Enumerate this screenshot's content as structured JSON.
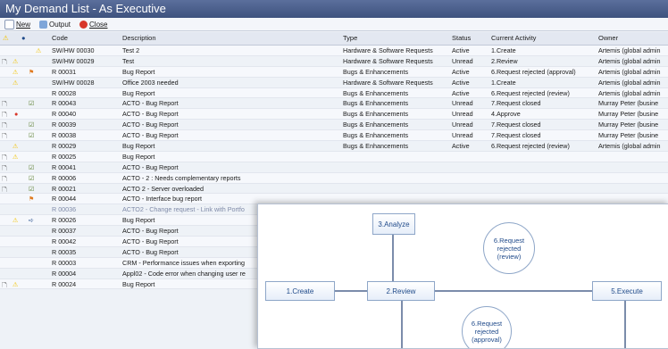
{
  "window": {
    "title": "My Demand List - As Executive"
  },
  "toolbar": {
    "new_label": "New",
    "output_label": "Output",
    "close_label": "Close"
  },
  "columns": {
    "code": "Code",
    "description": "Description",
    "type": "Type",
    "status": "Status",
    "activity": "Current Activity",
    "owner": "Owner"
  },
  "rows": [
    {
      "code": "SW/HW 00030",
      "description": "Test 2",
      "type": "Hardware & Software Requests",
      "status": "Active",
      "activity": "1.Create",
      "owner": "Artemis (global admin"
    },
    {
      "code": "SW/HW 00029",
      "description": "Test",
      "type": "Hardware & Software Requests",
      "status": "Unread",
      "activity": "2.Review",
      "owner": "Artemis (global admin"
    },
    {
      "code": "R 00031",
      "description": "Bug Report",
      "type": "Bugs & Enhancements",
      "status": "Active",
      "activity": "6.Request rejected (approval)",
      "owner": "Artemis (global admin"
    },
    {
      "code": "SW/HW 00028",
      "description": "Office 2003 needed",
      "type": "Hardware & Software Requests",
      "status": "Active",
      "activity": "1.Create",
      "owner": "Artemis (global admin"
    },
    {
      "code": "R 00028",
      "description": "Bug Report",
      "type": "Bugs & Enhancements",
      "status": "Active",
      "activity": "6.Request rejected (review)",
      "owner": "Artemis (global admin"
    },
    {
      "code": "R 00043",
      "description": "ACTO - Bug Report",
      "type": "Bugs & Enhancements",
      "status": "Unread",
      "activity": "7.Request closed",
      "owner": "Murray Peter (busine"
    },
    {
      "code": "R 00040",
      "description": "ACTO - Bug Report",
      "type": "Bugs & Enhancements",
      "status": "Unread",
      "activity": "4.Approve",
      "owner": "Murray Peter (busine"
    },
    {
      "code": "R 00039",
      "description": "ACTO - Bug Report",
      "type": "Bugs & Enhancements",
      "status": "Unread",
      "activity": "7.Request closed",
      "owner": "Murray Peter (busine"
    },
    {
      "code": "R 00038",
      "description": "ACTO - Bug Report",
      "type": "Bugs & Enhancements",
      "status": "Unread",
      "activity": "7.Request closed",
      "owner": "Murray Peter (busine"
    },
    {
      "code": "R 00029",
      "description": "Bug Report",
      "type": "Bugs & Enhancements",
      "status": "Active",
      "activity": "6.Request rejected (review)",
      "owner": "Artemis (global admin"
    },
    {
      "code": "R 00025",
      "description": "Bug Report",
      "type": "",
      "status": "",
      "activity": "",
      "owner": ""
    },
    {
      "code": "R 00041",
      "description": "ACTO - Bug Report",
      "type": "",
      "status": "",
      "activity": "",
      "owner": ""
    },
    {
      "code": "R 00006",
      "description": "ACTO - 2 : Needs complementary reports",
      "type": "",
      "status": "",
      "activity": "",
      "owner": ""
    },
    {
      "code": "R 00021",
      "description": "ACTO 2 - Server overloaded",
      "type": "",
      "status": "",
      "activity": "",
      "owner": ""
    },
    {
      "code": "R 00044",
      "description": "ACTO - Interface bug report",
      "type": "",
      "status": "",
      "activity": "",
      "owner": ""
    },
    {
      "code": "R 00036",
      "description": "ACTO2 - Change request - Link with Portfo",
      "type": "",
      "status": "",
      "activity": "",
      "owner": ""
    },
    {
      "code": "R 00026",
      "description": "Bug Report",
      "type": "",
      "status": "",
      "activity": "",
      "owner": ""
    },
    {
      "code": "R 00037",
      "description": "ACTO - Bug Report",
      "type": "",
      "status": "",
      "activity": "",
      "owner": ""
    },
    {
      "code": "R 00042",
      "description": "ACTO - Bug Report",
      "type": "",
      "status": "",
      "activity": "",
      "owner": ""
    },
    {
      "code": "R 00035",
      "description": "ACTO - Bug Report",
      "type": "",
      "status": "",
      "activity": "",
      "owner": ""
    },
    {
      "code": "R 00003",
      "description": "CRM - Performance issues when exporting",
      "type": "",
      "status": "",
      "activity": "",
      "owner": ""
    },
    {
      "code": "R 00004",
      "description": "Appl02 - Code error when changing user re",
      "type": "",
      "status": "",
      "activity": "",
      "owner": ""
    },
    {
      "code": "R 00024",
      "description": "Bug Report",
      "type": "",
      "status": "",
      "activity": "",
      "owner": ""
    }
  ],
  "workflow": {
    "analyze": "3.Analyze",
    "create": "1.Create",
    "review": "2.Review",
    "rejected_review": "6.Request rejected (review)",
    "rejected_approval": "6.Request rejected (approval)",
    "execute": "5.Execute"
  },
  "colors": {
    "title_bar": "#4a5e8c",
    "accent": "#1f4a8a",
    "warn": "#f2c200",
    "error": "#d8372a"
  }
}
